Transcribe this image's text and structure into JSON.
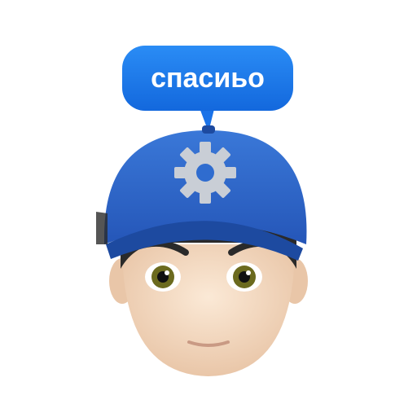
{
  "bubble": {
    "text": "спасиьо"
  },
  "colors": {
    "bubble": "#1a7ef0",
    "cap": "#2a64c8",
    "cap_dark": "#1d4aa0",
    "skin": "#f4dcc4",
    "hair": "#2a2a2a",
    "gear": "#c9ced6",
    "iris": "#6b6a1e"
  }
}
